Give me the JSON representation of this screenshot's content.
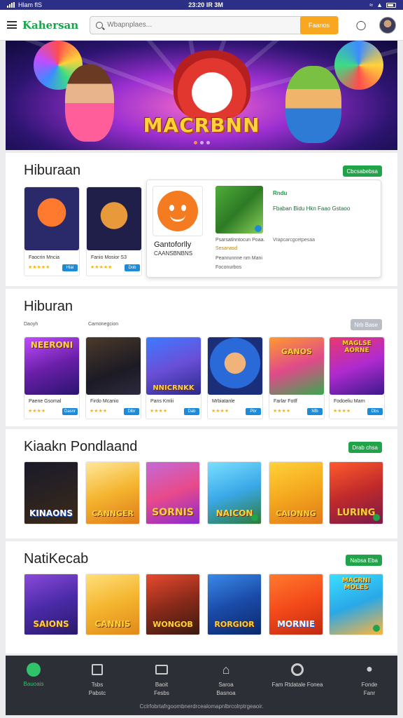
{
  "status": {
    "left": "Hlam flS",
    "time": "23:20 IR 3M"
  },
  "header": {
    "logo": "Kahersan",
    "search_placeholder": "Wbapnplaes...",
    "cta": "Faanos"
  },
  "banner": {
    "title": "MACRBNN"
  },
  "sections": [
    {
      "title": "Hiburaan",
      "action": "Cbcsabebsa"
    },
    {
      "title": "Hiburan",
      "sub_left": "Daoyh",
      "sub_right": "Camonegcion",
      "action": "Nrb Base"
    },
    {
      "title": "Kiaakn Pondlaand",
      "action": "Drab chsa"
    },
    {
      "title": "NatiKecab",
      "action": "Nabsa Eba"
    }
  ],
  "row1": [
    {
      "name": "Faocrin Mncia",
      "btn": "Hiai"
    },
    {
      "name": "Fanio Mosior  S3",
      "btn": "Dob"
    }
  ],
  "feature": {
    "title": "Gantoforlly",
    "subtitle": "CAANSBNBNS",
    "heading": "Rndu",
    "heading_line": "Fbaban  Bidu Hkn Faao  Gstaoo",
    "desc": [
      "Psarsatinntocun Poaa.",
      "Sesanasd",
      "Peanrunnne nm Mani",
      "Foconurbos"
    ],
    "right_note": "Vrapcarcgcetpesaa"
  },
  "row2": [
    {
      "caption": "NEERONI",
      "name": "Paene Gsomal",
      "btn": "Dasnr"
    },
    {
      "caption": "",
      "name": "Firdo Mcanio",
      "btn": "Dlbr"
    },
    {
      "caption": "NNICRNKK",
      "name": "Pans Kmlii",
      "btn": "Dab"
    },
    {
      "caption": "",
      "name": "Mrbiatanle",
      "btn": "Pbr"
    },
    {
      "caption": "GANOS",
      "name": "Farlar Fotlf",
      "btn": "Nfb"
    },
    {
      "caption": "MAGLSE AORNE",
      "name": "Fodoeliu Marn",
      "btn": "Dbs"
    }
  ],
  "row3": [
    {
      "caption": "KINAONS"
    },
    {
      "caption": "CANNGER"
    },
    {
      "caption": "SORNIS"
    },
    {
      "caption": "NAICON"
    },
    {
      "caption": "CAIONNG"
    },
    {
      "caption": "LURING"
    }
  ],
  "row4": [
    {
      "caption": "SAIONS"
    },
    {
      "caption": "CANNIS"
    },
    {
      "caption": "WONGOB"
    },
    {
      "caption": "RORGIOR"
    },
    {
      "caption": "MORNIE"
    },
    {
      "caption": "MACRNI MOLES"
    }
  ],
  "nav": [
    {
      "label": "Bauoais"
    },
    {
      "label": "Tsbs Pabstc"
    },
    {
      "label": "Baoit Fesbs"
    },
    {
      "label": "Saroa Basnoa"
    },
    {
      "label": "Fam Rtdatale Fonea"
    },
    {
      "label": "Fonde Fanr"
    }
  ],
  "footer": "Cclrfobrtafrgoombnerdrcealomapnlbrcolrptrgeaoir."
}
